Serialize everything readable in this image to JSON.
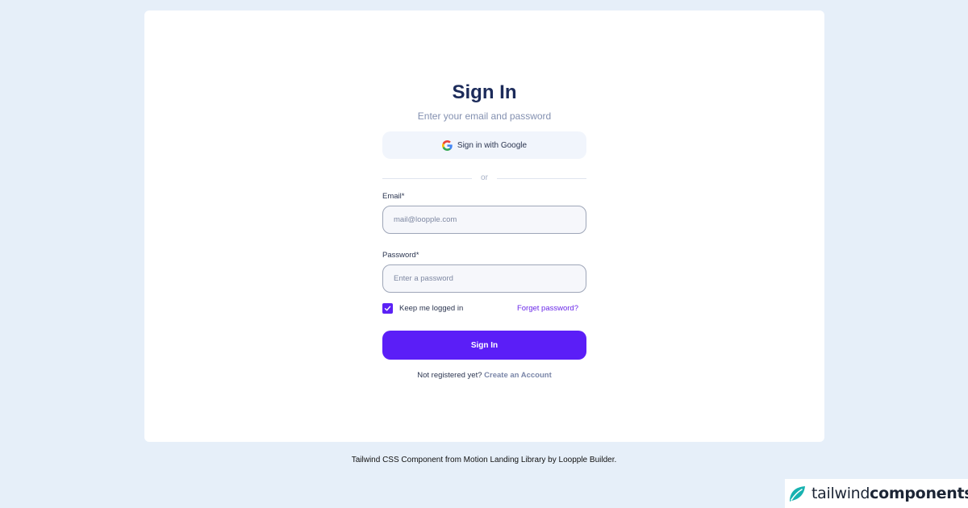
{
  "signin": {
    "title": "Sign In",
    "subtitle": "Enter your email and password",
    "google_button": {
      "label": "Sign in with Google",
      "icon": "google-icon"
    },
    "divider_text": "or",
    "email": {
      "label": "Email*",
      "placeholder": "mail@loopple.com",
      "value": ""
    },
    "password": {
      "label": "Password*",
      "placeholder": "Enter a password",
      "value": ""
    },
    "keep_logged_in": {
      "label": "Keep me logged in",
      "checked": true
    },
    "forget_password": "Forget password?",
    "submit_label": "Sign In",
    "register_prompt": "Not registered yet?",
    "register_link": "Create an Account"
  },
  "footer": {
    "credit": "Tailwind CSS Component from Motion Landing Library by Loopple Builder."
  },
  "brand": {
    "name_light": "tailwind",
    "name_bold": "components",
    "icon": "tailwind-leaf-icon"
  },
  "colors": {
    "page_background": "#e6eff9",
    "card_background": "#ffffff",
    "title": "#1c2b5a",
    "primary_button": "#5b1ef7",
    "checkbox": "#5b21f5",
    "link": "#6a28e8",
    "brand_leaf": "#18b2b0"
  }
}
